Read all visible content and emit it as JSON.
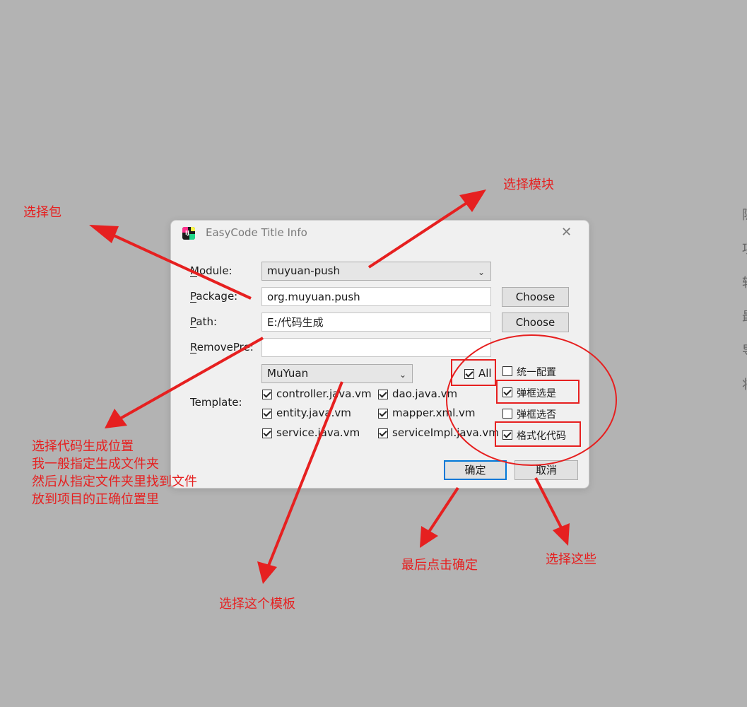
{
  "dialog": {
    "title": "EasyCode Title Info",
    "close_symbol": "✕",
    "module_label": "Module:",
    "module_value": "muyuan-push",
    "package_label": "Package:",
    "package_value": "org.muyuan.push",
    "path_label": "Path:",
    "path_value": "E:/代码生成",
    "removepre_label": "RemovePre:",
    "removepre_value": "",
    "choose_label": "Choose",
    "template_label": "Template:",
    "template_value": "MuYuan",
    "templates": {
      "controller": "controller.java.vm",
      "dao": "dao.java.vm",
      "entity": "entity.java.vm",
      "mapper": "mapper.xml.vm",
      "service": "service.java.vm",
      "serviceimpl": "serviceImpl.java.vm"
    },
    "all_label": "All",
    "options": {
      "unified_config": "统一配置",
      "popup_yes": "弹框选是",
      "popup_no": "弹框选否",
      "format_code": "格式化代码"
    },
    "ok_label": "确定",
    "cancel_label": "取消"
  },
  "annotations": {
    "select_package": "选择包",
    "select_module": "选择模块",
    "select_location_1": "选择代码生成位置",
    "select_location_2": "我一般指定生成文件夹",
    "select_location_3": "然后从指定文件夹里找到文件",
    "select_location_4": "放到项目的正确位置里",
    "select_template": "选择这个模板",
    "click_ok_last": "最后点击确定",
    "select_these": "选择这些"
  },
  "background_text": [
    "隐",
    "项",
    "转",
    "最",
    "导",
    "将"
  ],
  "colors": {
    "annotation": "#e62020",
    "background": "#b3b3b3",
    "dialog": "#f0f0f0",
    "primary_border": "#0078d7"
  }
}
